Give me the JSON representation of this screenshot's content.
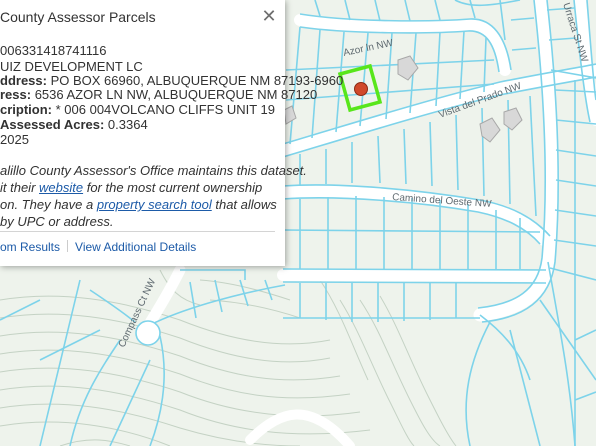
{
  "popup": {
    "title": "County Assessor Parcels",
    "close_icon": "close-icon",
    "fields": [
      {
        "label": "",
        "value": "006331418741116"
      },
      {
        "label": "",
        "value": "UIZ DEVELOPMENT LC"
      },
      {
        "label": "ddress:",
        "value": " PO BOX 66960, ALBUQUERQUE NM 87193-6960"
      },
      {
        "label": "ress:",
        "value": "  6536 AZOR LN NW, ALBUQUERQUE NM 87120"
      },
      {
        "label": "cription:",
        "value": " * 006 004VOLCANO CLIFFS UNIT 19"
      },
      {
        "label": "Assessed Acres:",
        "value": " 0.3364"
      },
      {
        "label": "",
        "value": "2025"
      }
    ],
    "description": {
      "line1": "alillo County Assessor's Office maintains this dataset.",
      "line2_pre": "it their ",
      "line2_link": "website",
      "line2_post": " for the most current ownership",
      "line3_pre": "on. They have a ",
      "line3_link": "property search tool",
      "line3_post": " that allows",
      "line4": "by UPC or address."
    },
    "actions": {
      "zoom_label": "om Results",
      "details_label": "View Additional Details"
    }
  },
  "map": {
    "streets": {
      "azor": "Azor ln NW",
      "prado": "Vista del Prado NW",
      "oeste": "Camino del Oeste NW",
      "compass": "Compass Ct NW",
      "urraca": "Urraca St NW"
    },
    "colors": {
      "parcel_line": "#7dd3ea",
      "road_fill": "#ffffff",
      "contour": "#c4d2c4",
      "highlight": "#58e61b",
      "marker": "#d0492a"
    }
  }
}
